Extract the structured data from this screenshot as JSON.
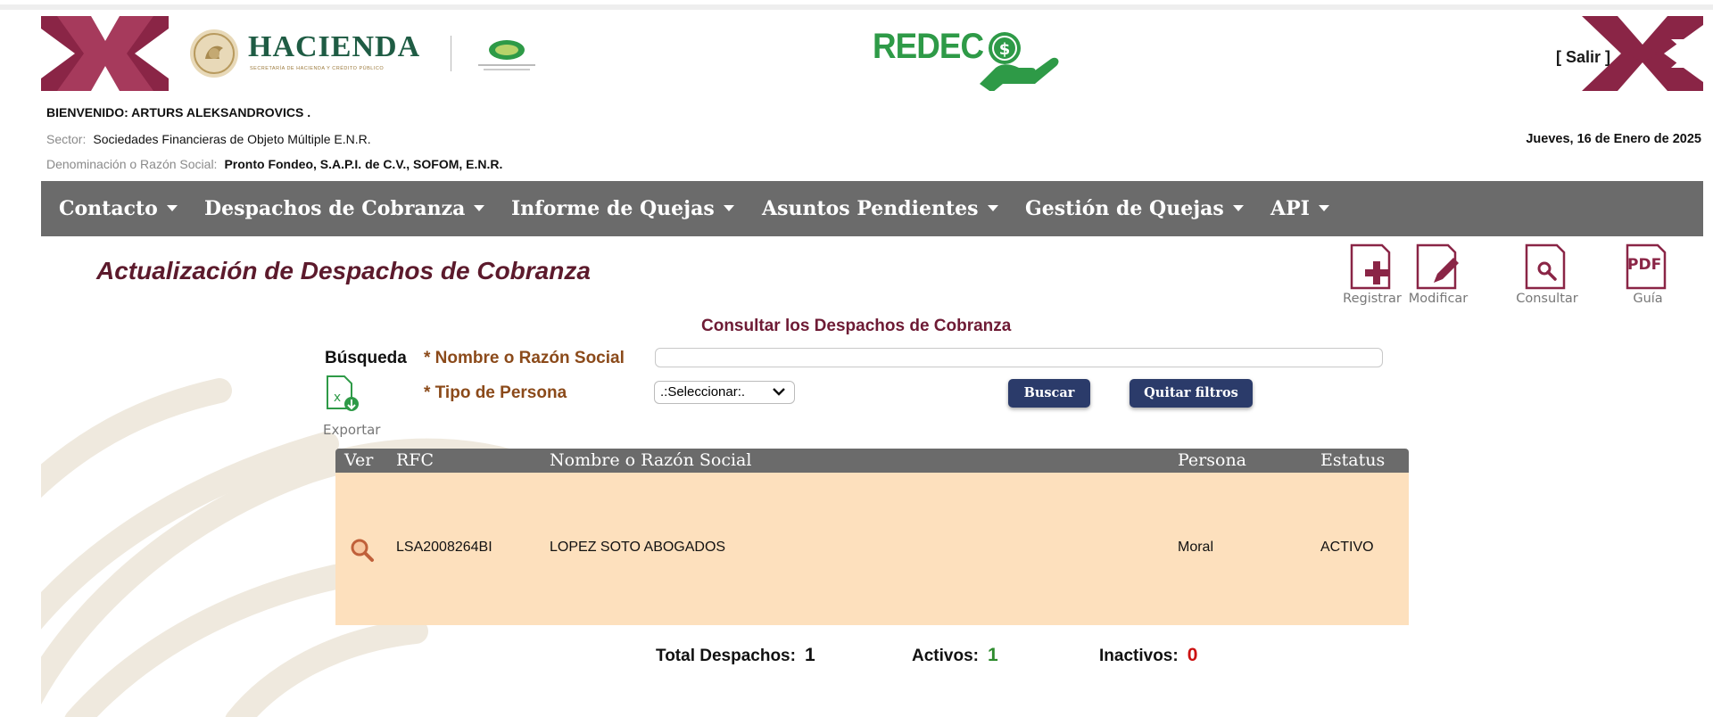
{
  "header": {
    "hacienda_title": "HACIENDA",
    "hacienda_subtitle": "SECRETARÍA DE HACIENDA Y CRÉDITO PÚBLICO",
    "redeco_logo_text": "REDEC",
    "salir_label": "[ Salir ]"
  },
  "user": {
    "welcome": "BIENVENIDO:  ARTURS ALEKSANDROVICS .",
    "sector_label": "Sector:",
    "sector_value": "Sociedades Financieras de Objeto Múltiple E.N.R.",
    "razon_label": "Denominación o Razón Social:",
    "razon_value": "Pronto Fondeo, S.A.P.I. de C.V., SOFOM, E.N.R.",
    "date": "Jueves, 16 de Enero de 2025"
  },
  "nav": {
    "items": [
      {
        "label": "Contacto"
      },
      {
        "label": "Despachos de Cobranza"
      },
      {
        "label": "Informe de Quejas"
      },
      {
        "label": "Asuntos Pendientes"
      },
      {
        "label": "Gestión de Quejas"
      },
      {
        "label": "API"
      }
    ]
  },
  "page": {
    "title": "Actualización de Despachos de Cobranza",
    "subtitle": "Consultar los Despachos de Cobranza"
  },
  "toolbar": {
    "registrar": "Registrar",
    "modificar": "Modificar",
    "consultar": "Consultar",
    "guia": "Guía",
    "pdf_text": "PDF"
  },
  "search": {
    "busqueda_label": "Búsqueda",
    "nombre_label": "* Nombre o Razón Social",
    "nombre_value": "",
    "tipo_label": "* Tipo de Persona",
    "tipo_selected": ".:Seleccionar:.",
    "buscar_label": "Buscar",
    "quitar_label": "Quitar filtros",
    "exportar_label": "Exportar"
  },
  "table": {
    "columns": [
      "Ver",
      "RFC",
      "Nombre o Razón Social",
      "Persona",
      "Estatus"
    ],
    "rows": [
      {
        "rfc": "LSA2008264BI",
        "nombre": "LOPEZ SOTO ABOGADOS",
        "persona": "Moral",
        "estatus": "ACTIVO"
      }
    ]
  },
  "totals": {
    "total_label": "Total Despachos:",
    "total_value": "1",
    "activos_label": "Activos:",
    "activos_value": "1",
    "inactivos_label": "Inactivos:",
    "inactivos_value": "0"
  },
  "colors": {
    "nav_bg": "#6b6b6b",
    "title": "#5c1a2c",
    "row_bg": "#fde0bd",
    "button_bg": "#2b3b6a",
    "brand_maroon": "#8a2546",
    "activos": "#2e8b2e",
    "inactivos": "#cc1111"
  }
}
